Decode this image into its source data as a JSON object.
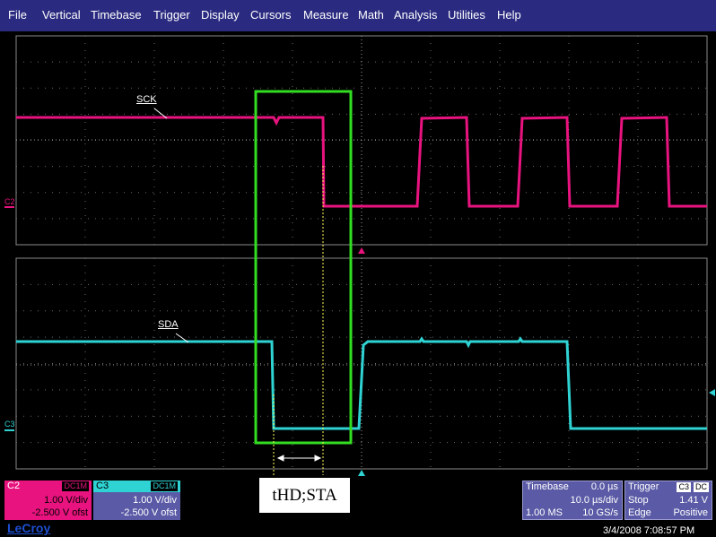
{
  "menu": [
    "File",
    "Vertical",
    "Timebase",
    "Trigger",
    "Display",
    "Cursors",
    "Measure",
    "Math",
    "Analysis",
    "Utilities",
    "Help"
  ],
  "traces": {
    "sck_label": "SCK",
    "sda_label": "SDA",
    "c2_marker": "C2",
    "c3_marker": "C3"
  },
  "annotation": {
    "measurement_label": "tHD;STA"
  },
  "channels": {
    "c2": {
      "name": "C2",
      "coupling": "DC1M",
      "scale": "1.00 V/div",
      "offset": "-2.500 V ofst"
    },
    "c3": {
      "name": "C3",
      "coupling": "DC1M",
      "scale": "1.00 V/div",
      "offset": "-2.500 V ofst"
    }
  },
  "timebase": {
    "title": "Timebase",
    "delay": "0.0 µs",
    "per_div": "10.0 µs/div",
    "samples": "1.00 MS",
    "rate": "10 GS/s"
  },
  "trigger": {
    "title": "Trigger",
    "source": "C3",
    "coupling": "DC",
    "mode": "Stop",
    "level": "1.41 V",
    "type": "Edge",
    "slope": "Positive"
  },
  "brand": "LeCroy",
  "datetime": "3/4/2008 7:08:57 PM",
  "colors": {
    "menubar": "#2a2a80",
    "c2": "#e8137e",
    "c3": "#2fd3d3",
    "highlight": "#33dd22",
    "grid": "#6a6a6a"
  }
}
